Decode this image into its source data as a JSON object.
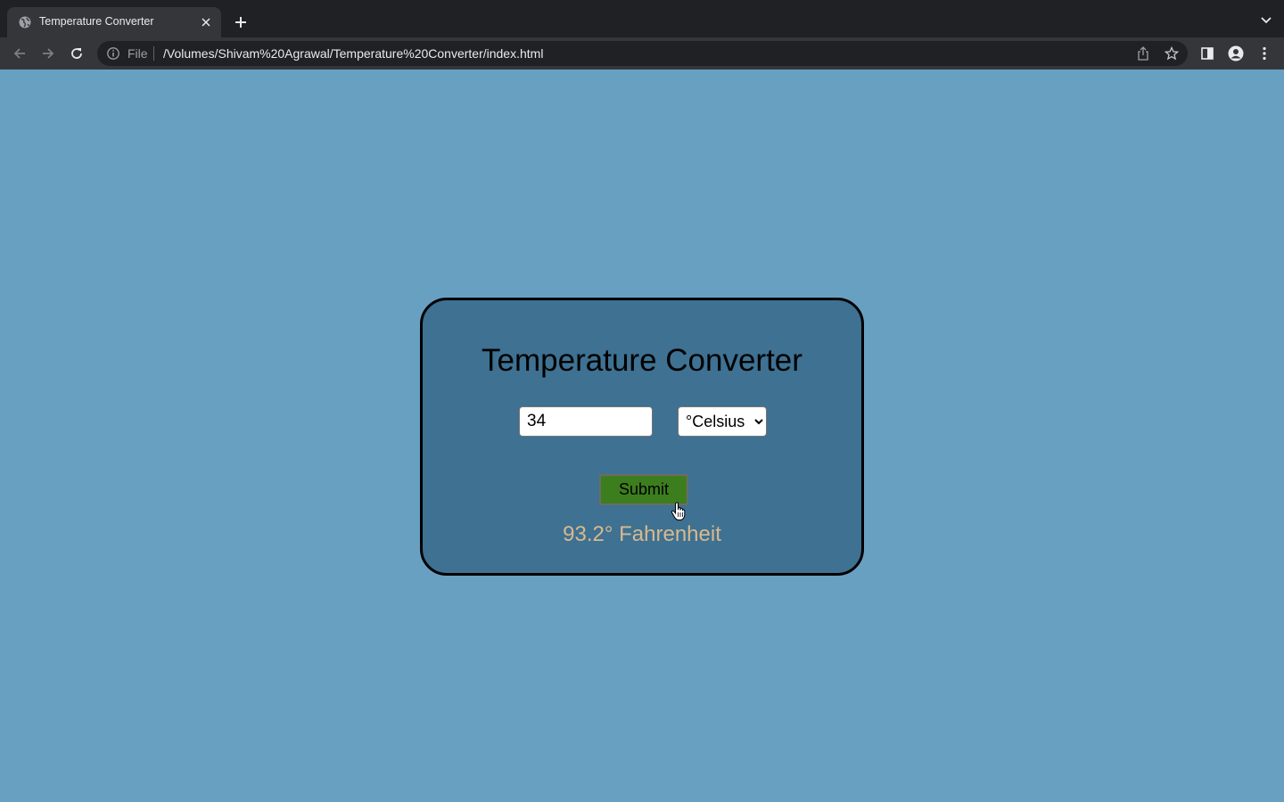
{
  "browser": {
    "tab": {
      "title": "Temperature Converter",
      "favicon": "globe-icon"
    },
    "new_tab_icon": "plus-icon",
    "tab_search_icon": "chevron-down-icon",
    "omnibox": {
      "scheme_label": "File",
      "url": "/Volumes/Shivam%20Agrawal/Temperature%20Converter/index.html"
    }
  },
  "page": {
    "background": "#68a0c2",
    "card_background": "#3e7192",
    "title": "Temperature Converter",
    "input": {
      "value": "34"
    },
    "unit_select": {
      "selected": "°Celsius",
      "options": [
        "°Celsius"
      ]
    },
    "submit_label": "Submit",
    "submit_color": "#3c7e1e",
    "result": "93.2° Fahrenheit",
    "result_color": "#d8b98d"
  }
}
